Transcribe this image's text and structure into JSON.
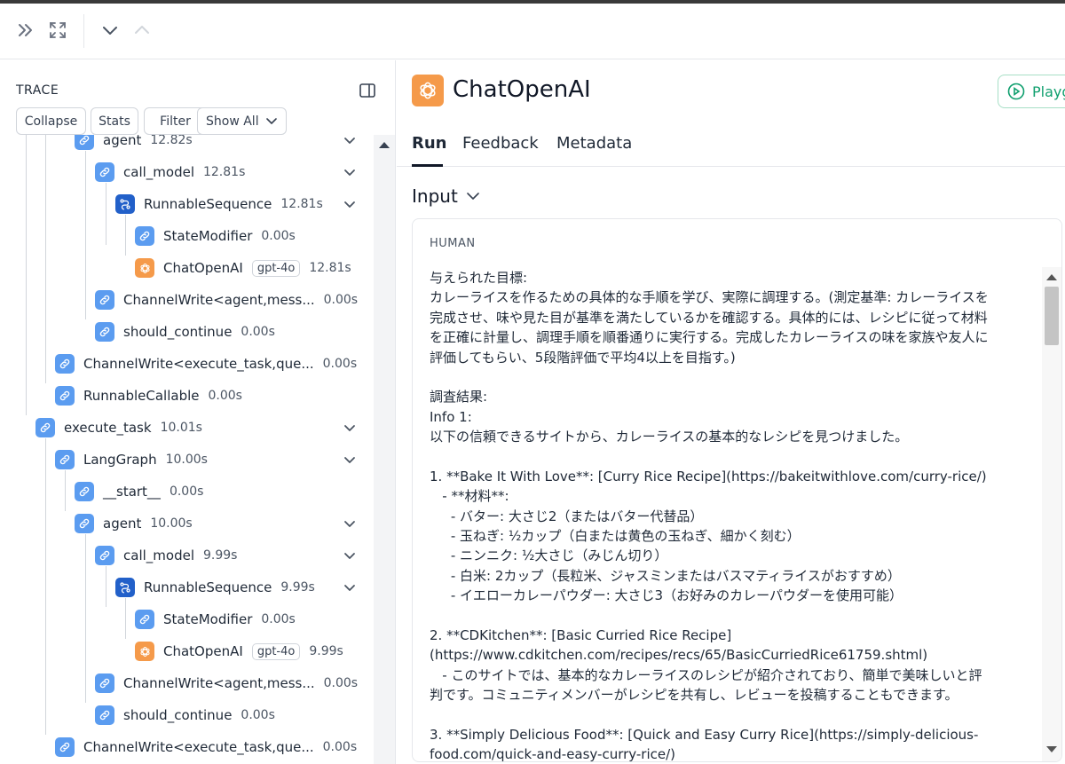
{
  "colors": {
    "chain": "#5b9cf0",
    "sequence": "#2260c9",
    "openai": "#f59a4a",
    "playground": "#0f9f6e"
  },
  "trace": {
    "title": "TRACE",
    "buttons": {
      "collapse": "Collapse",
      "stats": "Stats",
      "filter": "Filter",
      "show_all": "Show All"
    },
    "nodes": [
      {
        "name": "agent",
        "time": "12.82s",
        "tag": "",
        "icon": "chain-icon"
      },
      {
        "name": "call_model",
        "time": "12.81s",
        "tag": "",
        "icon": "chain-icon"
      },
      {
        "name": "RunnableSequence",
        "time": "12.81s",
        "tag": "",
        "icon": "sequence-icon"
      },
      {
        "name": "StateModifier",
        "time": "0.00s",
        "tag": "",
        "icon": "chain-icon"
      },
      {
        "name": "ChatOpenAI",
        "time": "12.81s",
        "tag": "gpt-4o",
        "icon": "openai-icon"
      },
      {
        "name": "ChannelWrite<agent,mess...",
        "time": "0.00s",
        "tag": "",
        "icon": "chain-icon"
      },
      {
        "name": "should_continue",
        "time": "0.00s",
        "tag": "",
        "icon": "chain-icon"
      },
      {
        "name": "ChannelWrite<execute_task,que...",
        "time": "0.00s",
        "tag": "",
        "icon": "chain-icon"
      },
      {
        "name": "RunnableCallable",
        "time": "0.00s",
        "tag": "",
        "icon": "chain-icon"
      },
      {
        "name": "execute_task",
        "time": "10.01s",
        "tag": "",
        "icon": "chain-icon"
      },
      {
        "name": "LangGraph",
        "time": "10.00s",
        "tag": "",
        "icon": "chain-icon"
      },
      {
        "name": "__start__",
        "time": "0.00s",
        "tag": "",
        "icon": "chain-icon"
      },
      {
        "name": "agent",
        "time": "10.00s",
        "tag": "",
        "icon": "chain-icon"
      },
      {
        "name": "call_model",
        "time": "9.99s",
        "tag": "",
        "icon": "chain-icon"
      },
      {
        "name": "RunnableSequence",
        "time": "9.99s",
        "tag": "",
        "icon": "sequence-icon"
      },
      {
        "name": "StateModifier",
        "time": "0.00s",
        "tag": "",
        "icon": "chain-icon"
      },
      {
        "name": "ChatOpenAI",
        "time": "9.99s",
        "tag": "gpt-4o",
        "icon": "openai-icon"
      },
      {
        "name": "ChannelWrite<agent,mess...",
        "time": "0.00s",
        "tag": "",
        "icon": "chain-icon"
      },
      {
        "name": "should_continue",
        "time": "0.00s",
        "tag": "",
        "icon": "chain-icon"
      },
      {
        "name": "ChannelWrite<execute_task,que...",
        "time": "0.00s",
        "tag": "",
        "icon": "chain-icon"
      }
    ]
  },
  "run": {
    "title": "ChatOpenAI",
    "playground_label": "Playg",
    "tabs": [
      "Run",
      "Feedback",
      "Metadata"
    ],
    "active_tab": "Run",
    "input_label": "Input",
    "message_role": "HUMAN",
    "message_lines": [
      "与えられた目標:",
      "カレーライスを作るための具体的な手順を学び、実際に調理する。(測定基準: カレーライスを",
      "完成させ、味や見た目が基準を満たしているかを確認する。具体的には、レシピに従って材料",
      "を正確に計量し、調理手順を順番通りに実行する。完成したカレーライスの味を家族や友人に",
      "評価してもらい、5段階評価で平均4以上を目指す。)",
      "",
      "調査結果:",
      "Info 1:",
      "以下の信頼できるサイトから、カレーライスの基本的なレシピを見つけました。",
      "",
      "1. **Bake It With Love**: [Curry Rice Recipe](https://bakeitwithlove.com/curry-rice/)",
      "   - **材料**:",
      "     - バター: 大さじ2（またはバター代替品）",
      "     - 玉ねぎ: ½カップ（白または黄色の玉ねぎ、細かく刻む）",
      "     - ニンニク: ½大さじ（みじん切り）",
      "     - 白米: 2カップ（長粒米、ジャスミンまたはバスマティライスがおすすめ）",
      "     - イエローカレーパウダー: 大さじ3（お好みのカレーパウダーを使用可能）",
      "",
      "2. **CDKitchen**: [Basic Curried Rice Recipe]",
      "(https://www.cdkitchen.com/recipes/recs/65/BasicCurriedRice61759.shtml)",
      "   - このサイトでは、基本的なカレーライスのレシピが紹介されており、簡単で美味しいと評",
      "判です。コミュニティメンバーがレシピを共有し、レビューを投稿することもできます。",
      "",
      "3. **Simply Delicious Food**: [Quick and Easy Curry Rice](https://simply-delicious-",
      "food.com/quick-and-easy-curry-rice/)"
    ]
  }
}
